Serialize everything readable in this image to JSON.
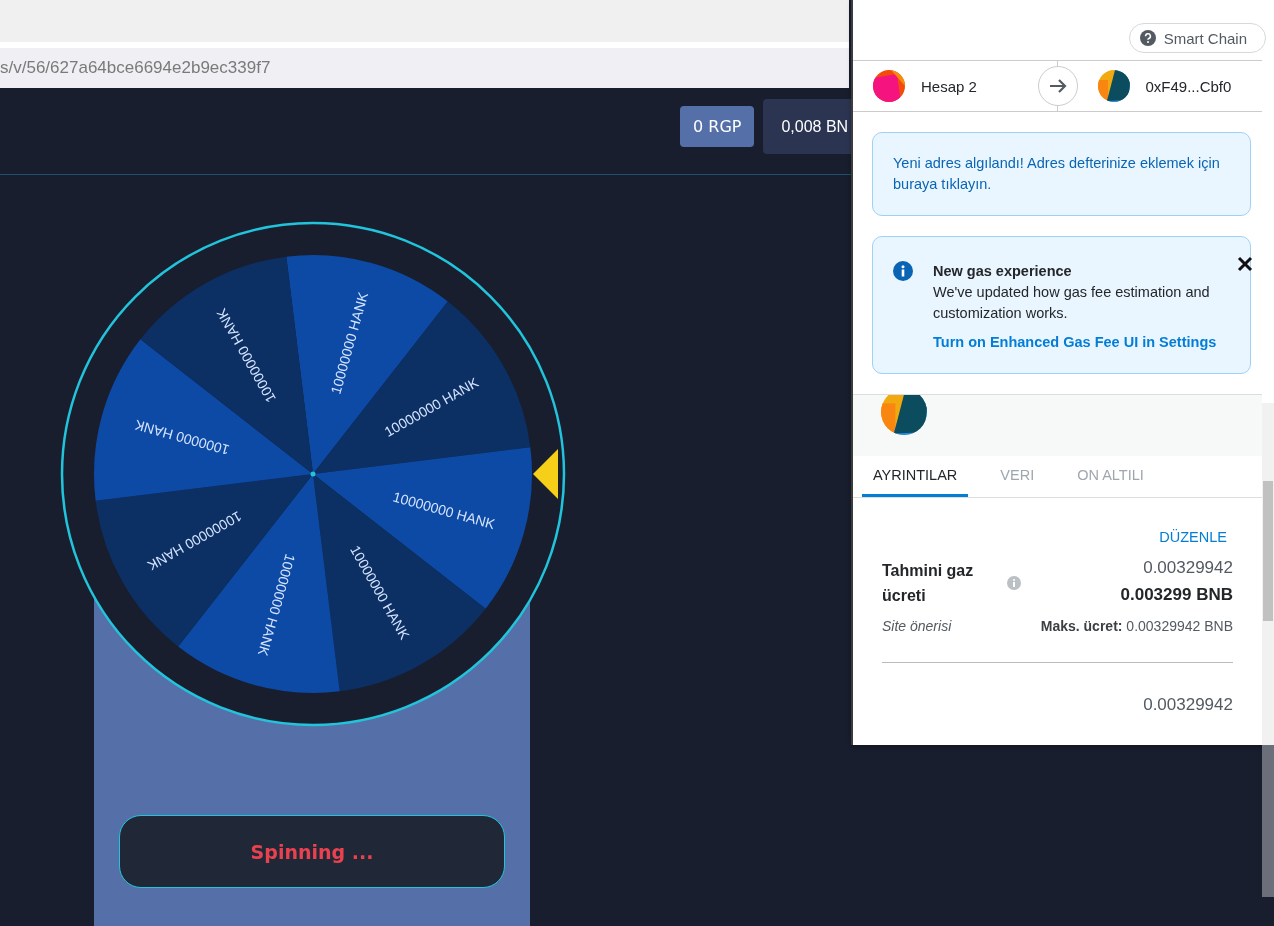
{
  "browser": {
    "url": "s/v/56/627a64bce6694e2b9ec339f7"
  },
  "header": {
    "buttons": [
      {
        "label": "0 RGP",
        "kind": "token"
      },
      {
        "label": "0,008 BN",
        "kind": "balance"
      }
    ]
  },
  "wheel": {
    "segments": [
      {
        "label": "10000000 HANK"
      },
      {
        "label": "10000000 HANK"
      },
      {
        "label": "10000000 HANK"
      },
      {
        "label": "10000000 HANK"
      },
      {
        "label": "10000000 HANK"
      },
      {
        "label": "10000000 HANK"
      },
      {
        "label": "1000000 HANK"
      },
      {
        "label": "10000000 HANK"
      }
    ]
  },
  "spin_button": {
    "label": "Spinning ..."
  },
  "popup": {
    "network": "Smart Chain",
    "from_account": "Hesap 2",
    "to_account": "0xF49...Cbf0",
    "notices": [
      {
        "kind": "plain",
        "text": "Yeni adres algılandı! Adres defterinize eklemek için buraya tıklayın."
      },
      {
        "kind": "info",
        "title": "New gas experience",
        "text": "We've updated how gas fee estimation and customization works.",
        "link": "Turn on Enhanced Gas Fee UI in Settings"
      }
    ],
    "tabs": [
      {
        "label": "AYRINTILAR",
        "selected": true
      },
      {
        "label": "VERI",
        "selected": false
      },
      {
        "label": "ON ALTILI",
        "selected": false
      }
    ],
    "edit_link": "DÜZENLE",
    "fee": {
      "label": "Tahmini gaz ücreti",
      "amount": "0.00329942",
      "amount_bnb": "0.003299 BNB",
      "source": "Site önerisi",
      "max_fee": "**Maks. ücret:** 0.00329942 BNB"
    },
    "next_amount": "0.00329942"
  }
}
